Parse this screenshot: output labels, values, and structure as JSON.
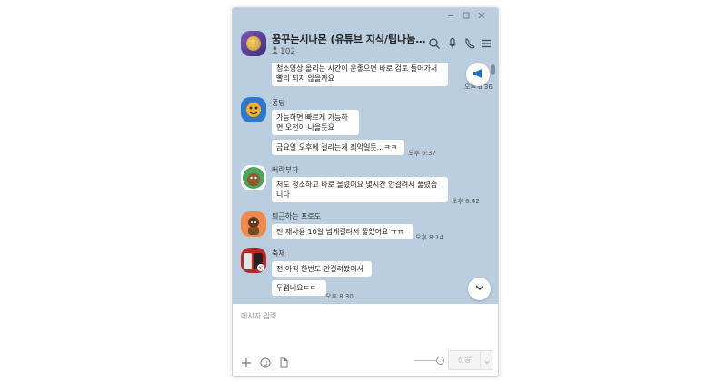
{
  "window": {
    "controls": [
      "minimize-icon",
      "maximize-icon",
      "close-icon"
    ]
  },
  "header": {
    "title": "꿈꾸는시나몬 (유튜브 지식/팁나눔, 토크...",
    "member_count": "102",
    "icons": [
      "search-icon",
      "microphone-icon",
      "phone-icon",
      "menu-icon"
    ]
  },
  "messages": [
    {
      "text": "청소영상 올리는 시간이 운좋으면 바로 검토 들어가서 빨리 되지 않을까요",
      "time": "오후 6:36"
    },
    {
      "sender": "퐁당",
      "text": "가능하면 빠르게 가능하면 오전이 나을듯요"
    },
    {
      "text": "금요일 오후에 걸리는게 최악일듯...ㅋㅋ",
      "time": "오후 6:37"
    },
    {
      "sender": "버락부자",
      "text": "저도 청소하고 바로 올렸어요 몇시간 안걸려서 풀렸습니다",
      "time": "오후 6:42"
    },
    {
      "sender": "퇴근하는 프로도",
      "text": "전 재사용 10일 넘게걸려서 풀었어요 ㅠㅠ",
      "time": "오후 8:14"
    },
    {
      "sender": "축재",
      "text": "전 아직 한번도 안걸려봤어서"
    },
    {
      "text": "두렵네요ㄷㄷ",
      "time": "오후 8:30"
    }
  ],
  "composer": {
    "placeholder": "메시지 입력",
    "send_label": "전송",
    "tools": [
      "plus-icon",
      "emoji-icon",
      "file-icon"
    ]
  },
  "colors": {
    "chat_bg": "#bacee0",
    "bubble_bg": "#ffffff",
    "accent": "#1a73c8"
  }
}
